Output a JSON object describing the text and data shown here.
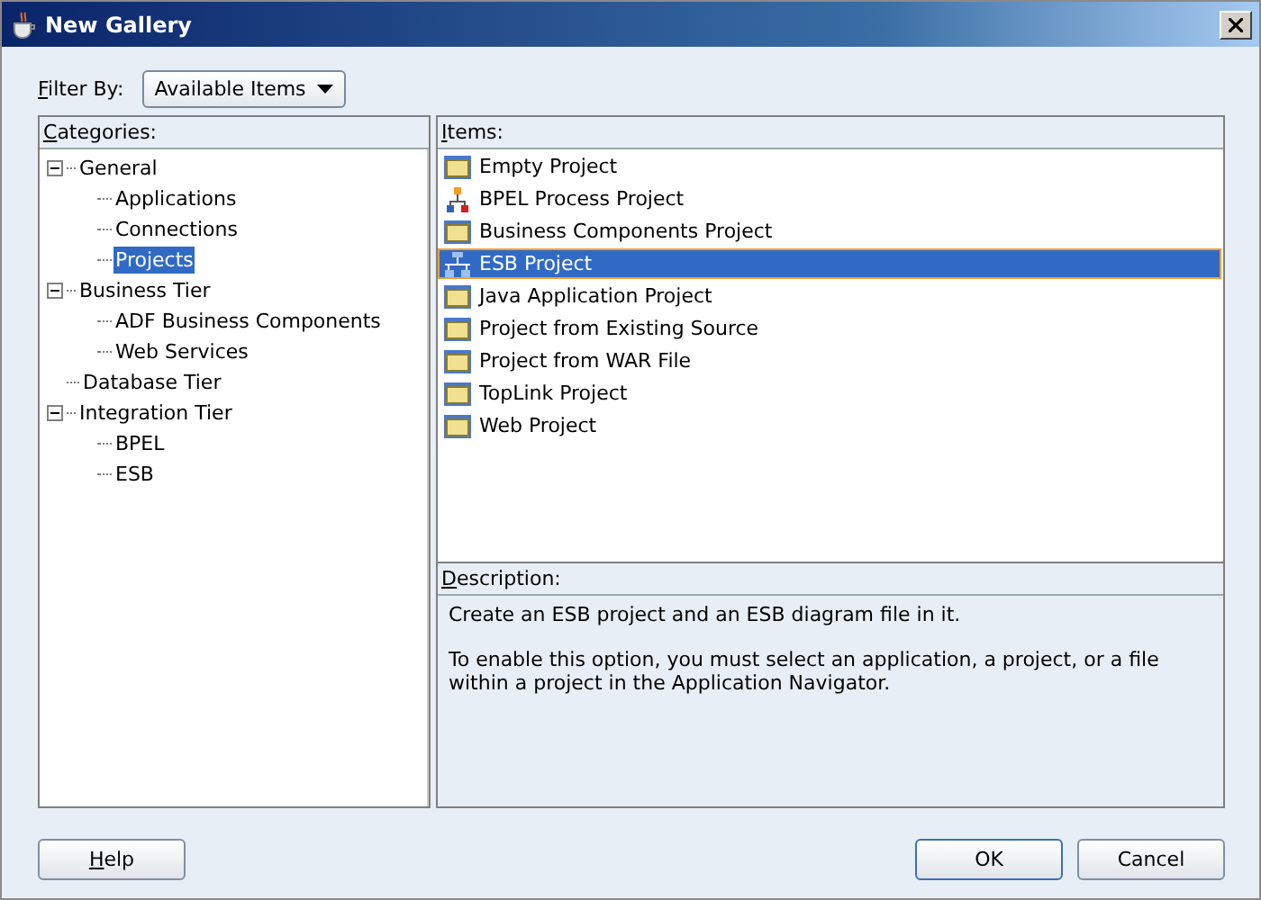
{
  "window": {
    "title": "New Gallery"
  },
  "filter": {
    "label": "Filter By:",
    "value": "Available Items"
  },
  "categories": {
    "heading": "Categories:",
    "tree": [
      {
        "label": "General",
        "expanded": true,
        "selected": false,
        "children": [
          {
            "label": "Applications",
            "selected": false
          },
          {
            "label": "Connections",
            "selected": false
          },
          {
            "label": "Projects",
            "selected": true
          }
        ]
      },
      {
        "label": "Business Tier",
        "expanded": true,
        "selected": false,
        "children": [
          {
            "label": "ADF Business Components",
            "selected": false
          },
          {
            "label": "Web Services",
            "selected": false
          }
        ]
      },
      {
        "label": "Database Tier",
        "selected": false
      },
      {
        "label": "Integration Tier",
        "expanded": true,
        "selected": false,
        "children": [
          {
            "label": "BPEL",
            "selected": false
          },
          {
            "label": "ESB",
            "selected": false
          }
        ]
      }
    ]
  },
  "items": {
    "heading": "Items:",
    "list": [
      {
        "label": "Empty Project",
        "kind": "folder",
        "selected": false
      },
      {
        "label": "BPEL Process Project",
        "kind": "process",
        "selected": false
      },
      {
        "label": "Business Components Project",
        "kind": "folder",
        "selected": false
      },
      {
        "label": "ESB Project",
        "kind": "bus",
        "selected": true
      },
      {
        "label": "Java Application Project",
        "kind": "folder",
        "selected": false
      },
      {
        "label": "Project from Existing Source",
        "kind": "folder",
        "selected": false
      },
      {
        "label": "Project from WAR File",
        "kind": "folder",
        "selected": false
      },
      {
        "label": "TopLink Project",
        "kind": "folder",
        "selected": false
      },
      {
        "label": "Web Project",
        "kind": "folder",
        "selected": false
      }
    ]
  },
  "description": {
    "heading": "Description:",
    "paragraphs": [
      "Create an ESB project and an ESB diagram file in it.",
      "To enable this option, you must select an application, a project, or a file within a project in the Application Navigator."
    ]
  },
  "buttons": {
    "help": "Help",
    "ok": "OK",
    "cancel": "Cancel"
  }
}
